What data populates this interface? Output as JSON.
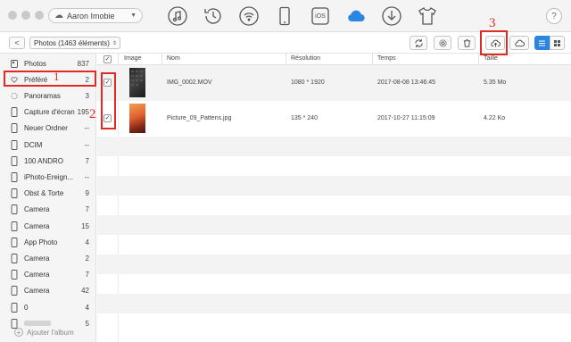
{
  "device": {
    "name": "Aaron Imobie",
    "icon": "cloud-icon"
  },
  "top_icons": [
    "music-icon",
    "history-icon",
    "wifi-icon",
    "phone-icon",
    "ios-icon",
    "icloud-icon",
    "download-icon",
    "shirt-icon"
  ],
  "top_ios_label": "iOS",
  "help_label": "?",
  "subbar": {
    "back_label": "<",
    "album_select": "Photos (1463 éléments)",
    "actions": [
      "refresh-icon",
      "settings-icon",
      "trash-icon",
      "upload-cloud-icon",
      "cloud-icon"
    ],
    "views": [
      "list-view-icon",
      "grid-view-icon"
    ]
  },
  "sidebar": {
    "items": [
      {
        "label": "Photos",
        "count": "837",
        "icon": "photo-icon"
      },
      {
        "label": "Préféré",
        "count": "2",
        "icon": "heart-icon"
      },
      {
        "label": "Panoramas",
        "count": "3",
        "icon": "panorama-icon"
      },
      {
        "label": "Capture d'écran",
        "count": "195",
        "icon": "phone-icon"
      },
      {
        "label": "Neuer Ordner",
        "count": "--",
        "icon": "phone-icon"
      },
      {
        "label": "DCIM",
        "count": "--",
        "icon": "phone-icon"
      },
      {
        "label": "100  ANDRO",
        "count": "7",
        "icon": "phone-icon"
      },
      {
        "label": "iPhoto-Ereign...",
        "count": "--",
        "icon": "phone-icon"
      },
      {
        "label": "Obst & Torte",
        "count": "9",
        "icon": "phone-icon"
      },
      {
        "label": "Camera",
        "count": "7",
        "icon": "phone-icon"
      },
      {
        "label": "Camera",
        "count": "15",
        "icon": "phone-icon"
      },
      {
        "label": "App Photo",
        "count": "4",
        "icon": "phone-icon"
      },
      {
        "label": "Camera",
        "count": "2",
        "icon": "phone-icon"
      },
      {
        "label": "Camera",
        "count": "7",
        "icon": "phone-icon"
      },
      {
        "label": "Camera",
        "count": "42",
        "icon": "phone-icon"
      },
      {
        "label": "0",
        "count": "4",
        "icon": "phone-icon"
      },
      {
        "label": "",
        "count": "5",
        "icon": "phone-icon"
      }
    ],
    "add_album": "Ajouter l'album"
  },
  "table": {
    "headers": {
      "image": "Image",
      "name": "Nom",
      "resolution": "Résolution",
      "time": "Temps",
      "size": "Taille"
    },
    "header_check": "✓",
    "rows": [
      {
        "checked": "✓",
        "name": "IMG_0002.MOV",
        "resolution": "1080 * 1920",
        "time": "2017-08-08 13:46:45",
        "size": "5.35 Mo"
      },
      {
        "checked": "✓",
        "name": "Picture_09_Pattens.jpg",
        "resolution": "135 * 240",
        "time": "2017-10-27 11:15:09",
        "size": "4.22 Ko"
      }
    ]
  },
  "annotations": {
    "n1": "1",
    "n2": "2",
    "n3": "3"
  },
  "colors": {
    "accent": "#2a86e0",
    "annotation": "#e02b25"
  }
}
